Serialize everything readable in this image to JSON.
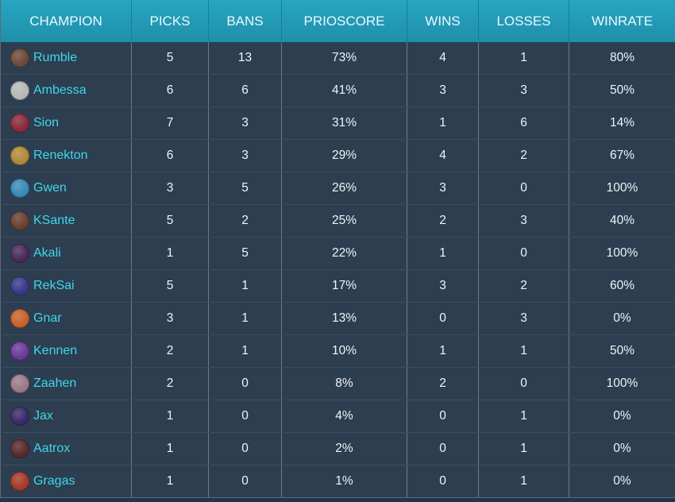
{
  "table": {
    "columns": [
      "CHAMPION",
      "PICKS",
      "BANS",
      "PRIOSCORE",
      "WINS",
      "LOSSES",
      "WINRATE"
    ],
    "rows": [
      {
        "champion": "Rumble",
        "picks": "5",
        "bans": "13",
        "prioscore": "73%",
        "wins": "4",
        "losses": "1",
        "winrate": "80%",
        "avatar_color": "#6b4a3a"
      },
      {
        "champion": "Ambessa",
        "picks": "6",
        "bans": "6",
        "prioscore": "41%",
        "wins": "3",
        "losses": "3",
        "winrate": "50%",
        "avatar_color": "#b8b8b8"
      },
      {
        "champion": "Sion",
        "picks": "7",
        "bans": "3",
        "prioscore": "31%",
        "wins": "1",
        "losses": "6",
        "winrate": "14%",
        "avatar_color": "#8a2a3a"
      },
      {
        "champion": "Renekton",
        "picks": "6",
        "bans": "3",
        "prioscore": "29%",
        "wins": "4",
        "losses": "2",
        "winrate": "67%",
        "avatar_color": "#b08a3a"
      },
      {
        "champion": "Gwen",
        "picks": "3",
        "bans": "5",
        "prioscore": "26%",
        "wins": "3",
        "losses": "0",
        "winrate": "100%",
        "avatar_color": "#3a8ab8"
      },
      {
        "champion": "KSante",
        "picks": "5",
        "bans": "2",
        "prioscore": "25%",
        "wins": "2",
        "losses": "3",
        "winrate": "40%",
        "avatar_color": "#6a4030"
      },
      {
        "champion": "Akali",
        "picks": "1",
        "bans": "5",
        "prioscore": "22%",
        "wins": "1",
        "losses": "0",
        "winrate": "100%",
        "avatar_color": "#4a2a5a"
      },
      {
        "champion": "RekSai",
        "picks": "5",
        "bans": "1",
        "prioscore": "17%",
        "wins": "3",
        "losses": "2",
        "winrate": "60%",
        "avatar_color": "#3a3a8a"
      },
      {
        "champion": "Gnar",
        "picks": "3",
        "bans": "1",
        "prioscore": "13%",
        "wins": "0",
        "losses": "3",
        "winrate": "0%",
        "avatar_color": "#c8632a"
      },
      {
        "champion": "Kennen",
        "picks": "2",
        "bans": "1",
        "prioscore": "10%",
        "wins": "1",
        "losses": "1",
        "winrate": "50%",
        "avatar_color": "#6a3a9a"
      },
      {
        "champion": "Zaahen",
        "picks": "2",
        "bans": "0",
        "prioscore": "8%",
        "wins": "2",
        "losses": "0",
        "winrate": "100%",
        "avatar_color": "#9a7a8a"
      },
      {
        "champion": "Jax",
        "picks": "1",
        "bans": "0",
        "prioscore": "4%",
        "wins": "0",
        "losses": "1",
        "winrate": "0%",
        "avatar_color": "#3a2a6a"
      },
      {
        "champion": "Aatrox",
        "picks": "1",
        "bans": "0",
        "prioscore": "2%",
        "wins": "0",
        "losses": "1",
        "winrate": "0%",
        "avatar_color": "#5a2a2a"
      },
      {
        "champion": "Gragas",
        "picks": "1",
        "bans": "0",
        "prioscore": "1%",
        "wins": "0",
        "losses": "1",
        "winrate": "0%",
        "avatar_color": "#a83a2a"
      }
    ]
  }
}
